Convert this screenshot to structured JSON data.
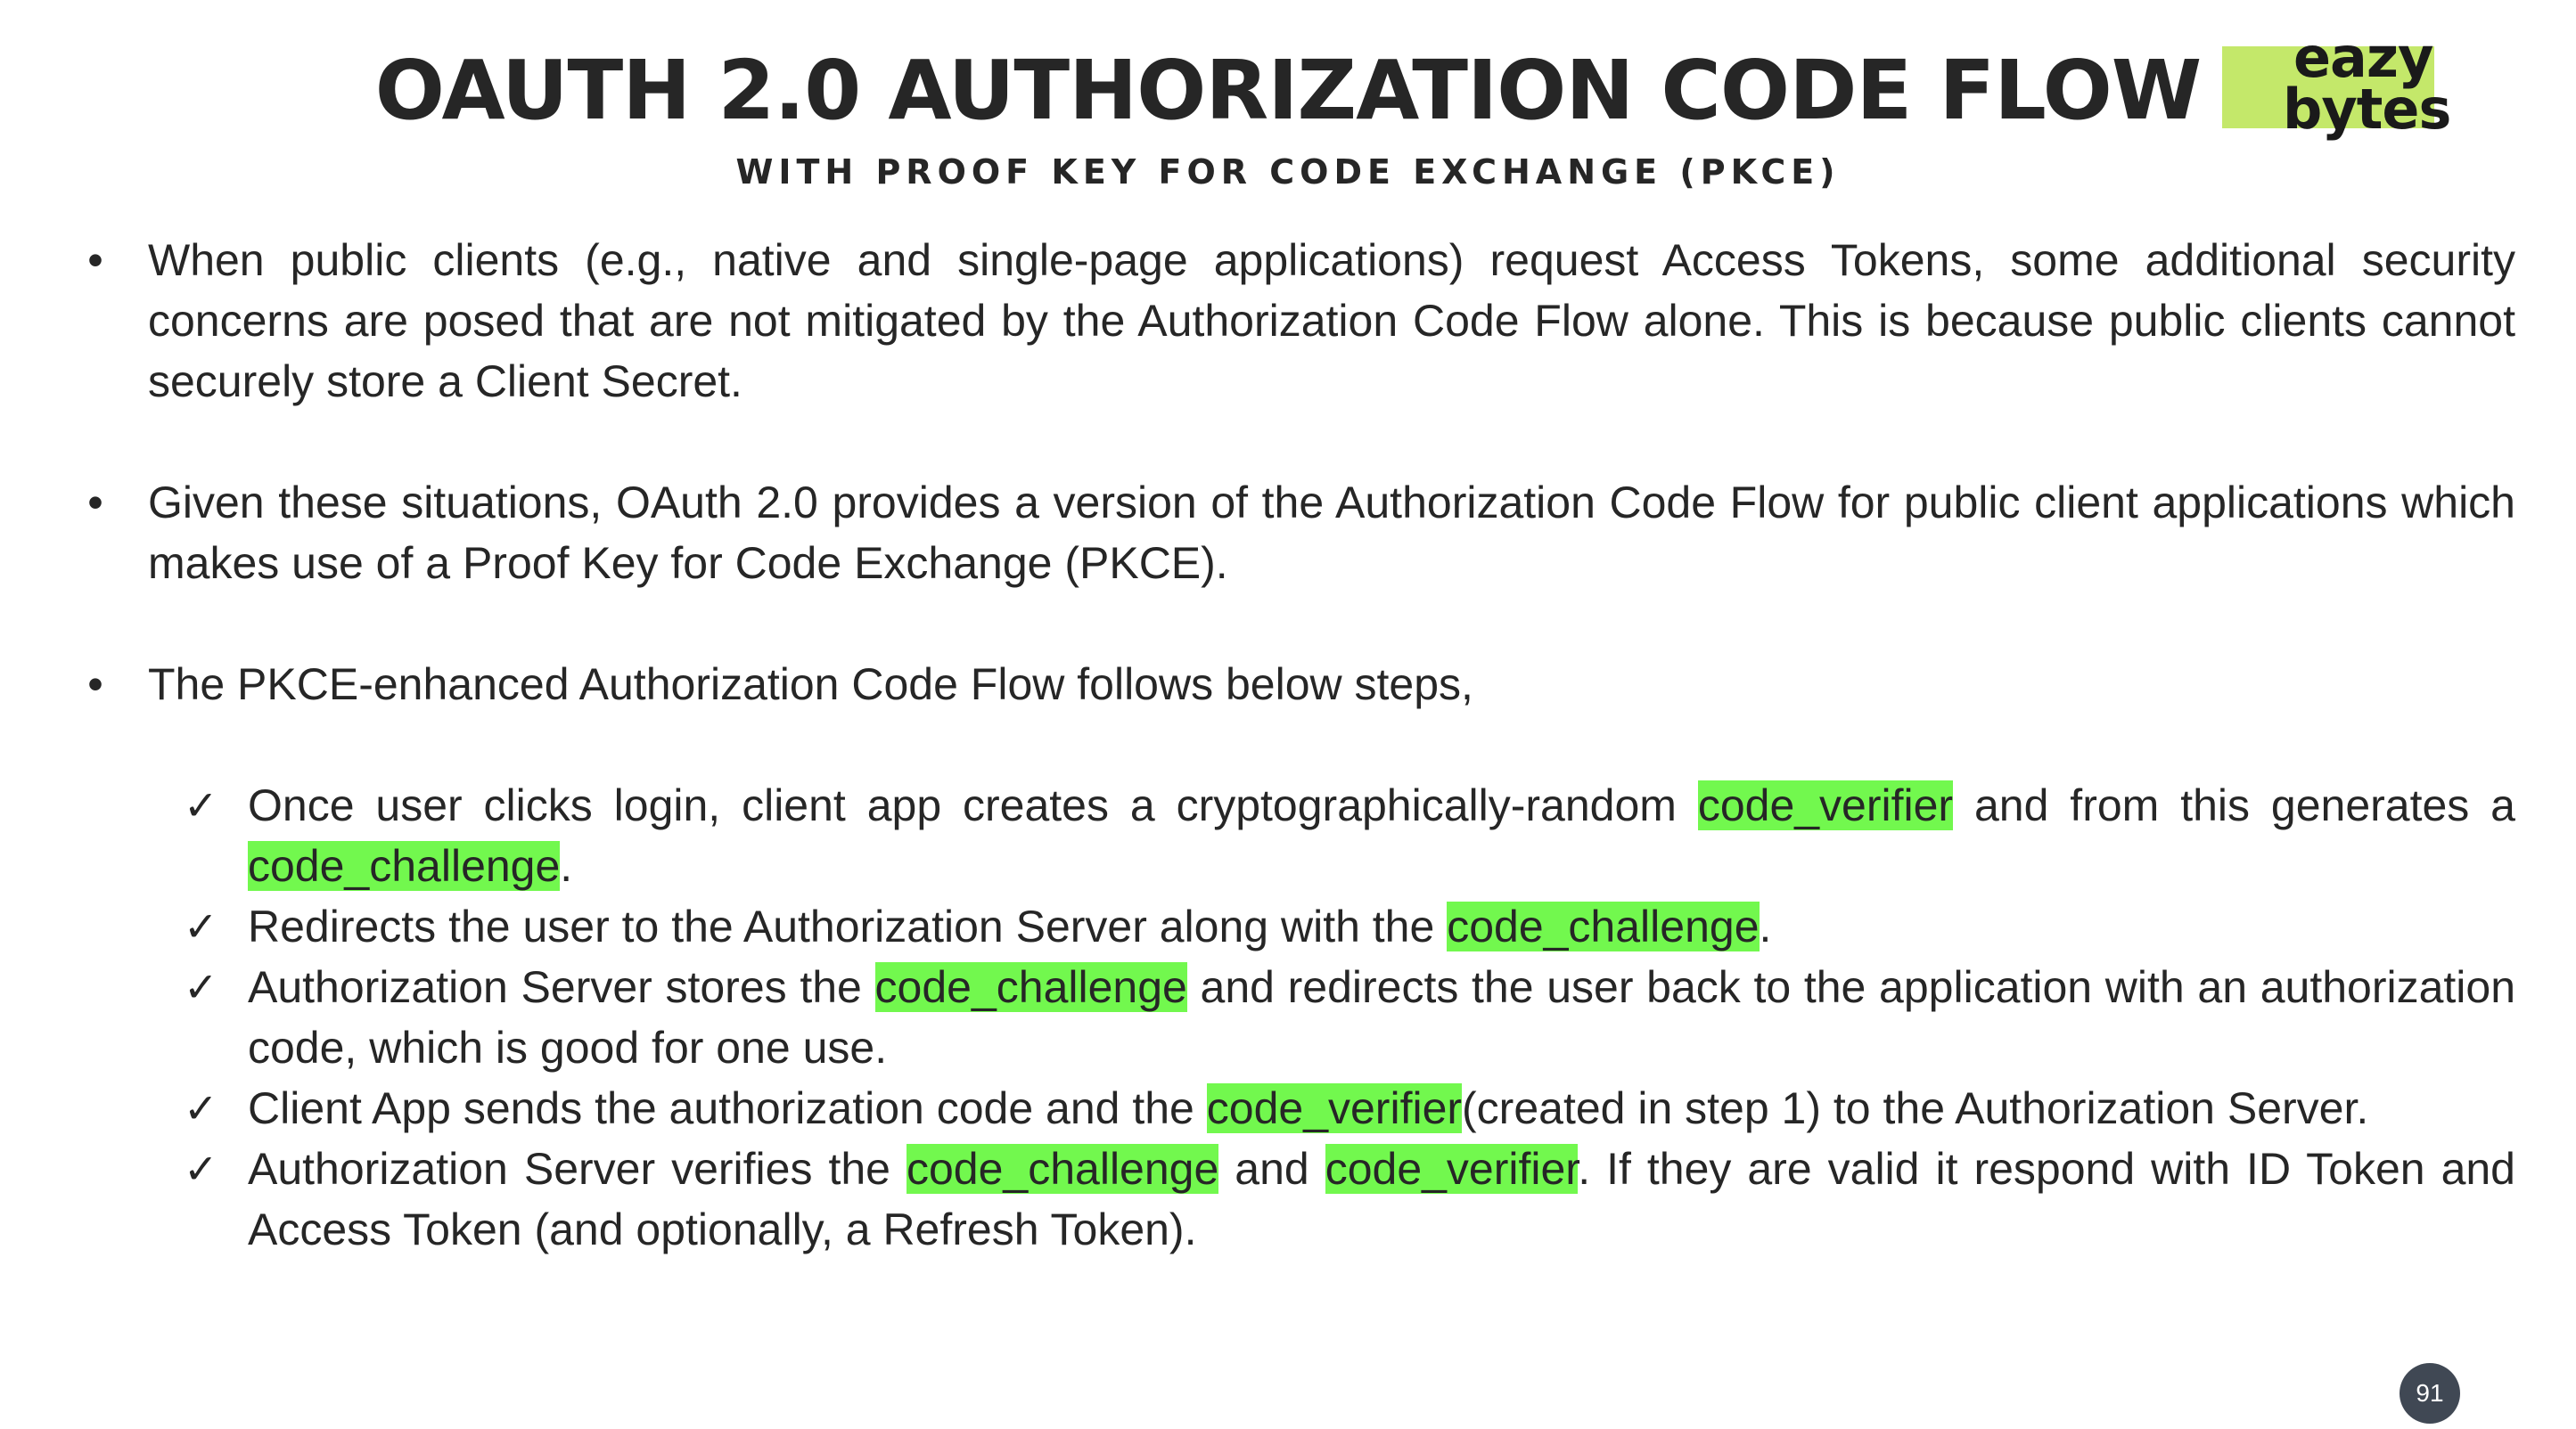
{
  "slide": {
    "title": "OAUTH 2.0 AUTHORIZATION CODE FLOW",
    "subtitle": "WITH PROOF KEY FOR CODE EXCHANGE (PKCE)",
    "logo": {
      "line1": "eazy",
      "line2": "bytes",
      "background_color": "#c4e86a"
    },
    "page_number": "91"
  },
  "colors": {
    "highlight": "#72f84e",
    "text": "#262626",
    "page_badge": "#404854"
  },
  "bullets": [
    {
      "text": "When public clients (e.g., native and single-page applications) request Access Tokens, some additional security concerns are posed that are not mitigated by the Authorization Code Flow alone. This is because public clients cannot securely store a Client Secret."
    },
    {
      "text": "Given these situations, OAuth 2.0 provides a version of the Authorization Code Flow for public client applications which makes use of a Proof Key for Code Exchange (PKCE)."
    },
    {
      "text": "The PKCE-enhanced Authorization Code Flow follows below steps,"
    }
  ],
  "bullet_symbol": "•",
  "check_symbol": "✓",
  "steps": [
    {
      "part1": "Once user clicks login, client app creates a cryptographically-random ",
      "hl1": "code_verifier",
      "part2": " and from this generates a ",
      "hl2": "code_challenge",
      "part3": "."
    },
    {
      "part1": "Redirects the user to the Authorization Server along with the ",
      "hl1": "code_challenge",
      "part2": "."
    },
    {
      "part1": "Authorization Server stores the ",
      "hl1": "code_challenge",
      "part2": " and redirects the user back to the application with an authorization code, which is good for one use."
    },
    {
      "part1": "Client App sends the authorization code and the ",
      "hl1": "code_verifier",
      "part2": "(created in step 1) to the Authorization Server."
    },
    {
      "part1": "Authorization Server verifies the ",
      "hl1": "code_challenge",
      "part2": " and ",
      "hl2": "code_verifier",
      "part3": ". If they are valid it respond with ID Token and Access Token (and optionally, a Refresh Token)."
    }
  ]
}
